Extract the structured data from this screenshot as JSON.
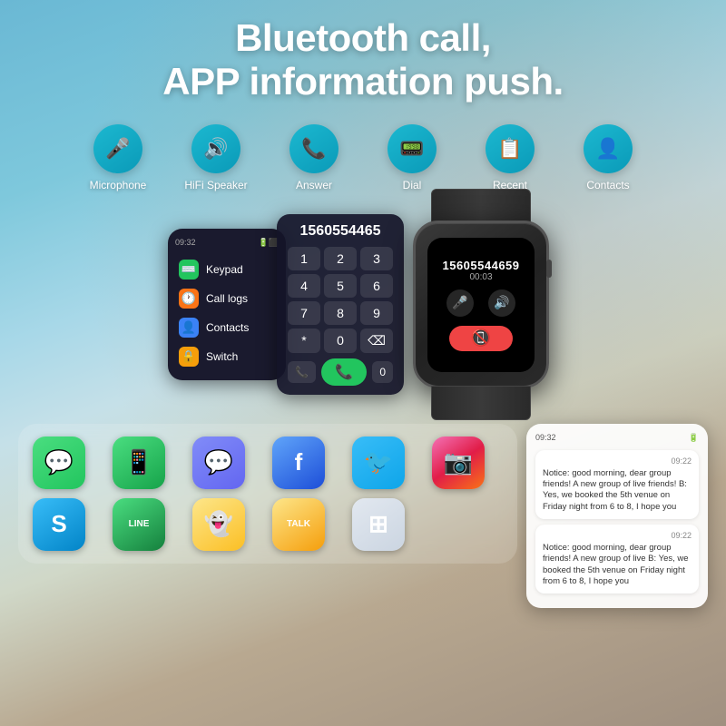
{
  "header": {
    "line1": "Bluetooth call,",
    "line2": "APP information push."
  },
  "features": [
    {
      "id": "microphone",
      "label": "Microphone",
      "icon": "🎤"
    },
    {
      "id": "hifi-speaker",
      "label": "HiFi Speaker",
      "icon": "🔊"
    },
    {
      "id": "answer",
      "label": "Answer",
      "icon": "📞"
    },
    {
      "id": "dial",
      "label": "Dial",
      "icon": "📟"
    },
    {
      "id": "recent",
      "label": "Recent",
      "icon": "📋"
    },
    {
      "id": "contacts",
      "label": "Contacts",
      "icon": "👤"
    }
  ],
  "phone_menu": {
    "status_time": "09:32",
    "status_battery": "🔋",
    "items": [
      {
        "id": "keypad",
        "label": "Keypad",
        "icon": "⌨️",
        "color_class": "icon-green"
      },
      {
        "id": "call-logs",
        "label": "Call logs",
        "icon": "🕐",
        "color_class": "icon-orange"
      },
      {
        "id": "contacts",
        "label": "Contacts",
        "icon": "👤",
        "color_class": "icon-blue"
      },
      {
        "id": "switch",
        "label": "Switch",
        "icon": "🔒",
        "color_class": "icon-yellow"
      }
    ]
  },
  "dialpad": {
    "number": "1560554465",
    "keys": [
      "1",
      "2",
      "3",
      "4",
      "5",
      "6",
      "7",
      "8",
      "9",
      "*",
      "0",
      "⌫"
    ]
  },
  "watch_screen": {
    "number": "15605544659",
    "timer": "00:03",
    "mic_icon": "🎤",
    "speaker_icon": "🔊",
    "end_icon": "📵"
  },
  "apps": [
    {
      "id": "messages",
      "icon": "💬",
      "color": "app-messages"
    },
    {
      "id": "whatsapp",
      "icon": "📱",
      "color": "app-whatsapp"
    },
    {
      "id": "messenger",
      "icon": "💬",
      "color": "app-messenger"
    },
    {
      "id": "facebook",
      "icon": "f",
      "color": "app-facebook"
    },
    {
      "id": "twitter",
      "icon": "🐦",
      "color": "app-twitter"
    },
    {
      "id": "instagram",
      "icon": "📷",
      "color": "app-instagram"
    },
    {
      "id": "skype",
      "icon": "S",
      "color": "app-skype"
    },
    {
      "id": "line",
      "icon": "LINE",
      "color": "app-line"
    },
    {
      "id": "snapchat",
      "icon": "👻",
      "color": "app-snapchat"
    },
    {
      "id": "kakao",
      "icon": "TALK",
      "color": "app-kakao"
    },
    {
      "id": "grid4",
      "icon": "⊞",
      "color": "app-grid4"
    }
  ],
  "notifications": {
    "status_time": "09:32",
    "items": [
      {
        "time": "09:22",
        "text": "Notice: good morning, dear group friends! A new group of live friends! B: Yes, we booked the 5th venue on Friday night from 6 to 8, I hope you"
      },
      {
        "time": "09:22",
        "text": "Notice: good morning, dear group friends! A new group of live B: Yes, we booked the 5th venue on Friday night from 6 to 8, I hope you"
      }
    ]
  }
}
